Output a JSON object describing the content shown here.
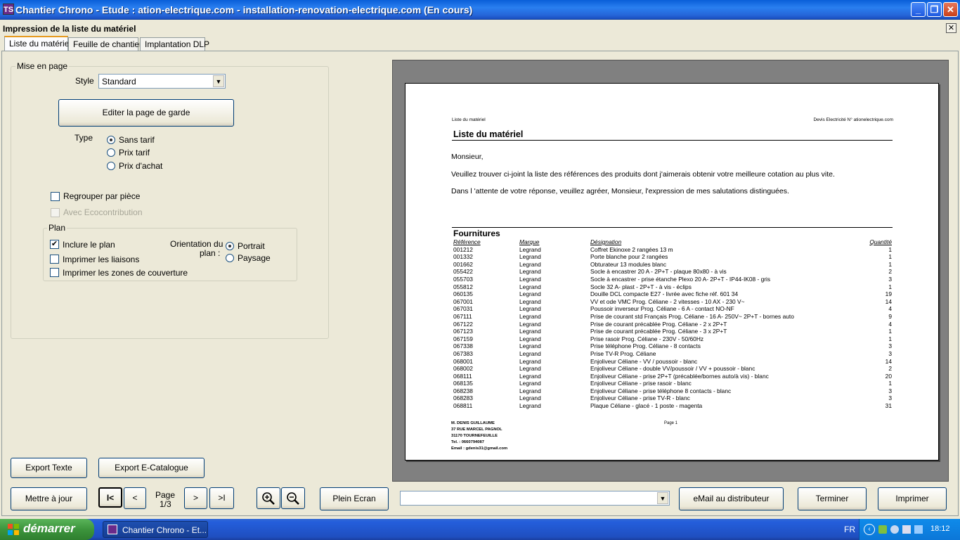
{
  "window": {
    "title": "Chantier Chrono - Etude : ation-electrique.com - installation-renovation-electrique.com (En cours)",
    "app_icon_text": "TS"
  },
  "dialog": {
    "title": "Impression de la liste du matériel",
    "close_glyph": "✕"
  },
  "tabs": [
    {
      "label": "Liste du matériel",
      "active": true
    },
    {
      "label": "Feuille de chantier",
      "active": false
    },
    {
      "label": "Implantation DLP",
      "active": false
    }
  ],
  "settings": {
    "group_title": "Mise en page",
    "style_label": "Style",
    "style_value": "Standard",
    "edit_cover_button": "Editer la page de garde",
    "type_label": "Type",
    "type_options": [
      "Sans tarif",
      "Prix tarif",
      "Prix d'achat"
    ],
    "type_selected": "Sans tarif",
    "group_by_room": "Regrouper par pièce",
    "eco_contribution": "Avec Ecocontribution",
    "plan_group_title": "Plan",
    "include_plan": "Inclure le plan",
    "print_links": "Imprimer les liaisons",
    "print_coverage": "Imprimer les zones de couverture",
    "orientation_label_1": "Orientation du",
    "orientation_label_2": "plan :",
    "orientation_options": [
      "Portrait",
      "Paysage"
    ],
    "orientation_selected": "Portrait",
    "export_text_button": "Export Texte",
    "export_ecatalogue_button": "Export E-Catalogue"
  },
  "preview": {
    "header_left": "Liste du matériel",
    "header_right": "Devis Electricité N° ationelectrique.com",
    "title": "Liste du matériel",
    "salutation": "Monsieur,",
    "paragraph1": "Veuillez trouver ci-joint la liste des références des produits dont j'aimerais obtenir votre meilleure cotation au plus vite.",
    "paragraph2": "Dans l 'attente de votre réponse, veuillez agréer, Monsieur, l'expression de mes salutations distinguées.",
    "section_title": "Fournitures",
    "columns": [
      "Référence",
      "Marque",
      "Désignation",
      "Quantité"
    ],
    "rows": [
      [
        "001212",
        "Legrand",
        "Coffret Ekinoxe 2 rangées 13 m",
        "1"
      ],
      [
        "001332",
        "Legrand",
        "Porte blanche pour 2 rangées",
        "1"
      ],
      [
        "001662",
        "Legrand",
        "Obturateur 13 modules blanc",
        "1"
      ],
      [
        "055422",
        "Legrand",
        "Socle à encastrer 20 A - 2P+T - plaque 80x80 - à vis",
        "2"
      ],
      [
        "055703",
        "Legrand",
        "Socle à encastrer - prise étanche Plexo 20 A- 2P+T - IP44-IK08 - gris",
        "3"
      ],
      [
        "055812",
        "Legrand",
        "Socle 32 A- plast - 2P+T - à vis - éclips",
        "1"
      ],
      [
        "060135",
        "Legrand",
        "Douille DCL compacte E27 - livrée avec fiche réf. 601 34",
        "19"
      ],
      [
        "067001",
        "Legrand",
        "VV et ode VMC Prog. Céliane - 2 vitesses - 10 AX - 230 V~",
        "14"
      ],
      [
        "067031",
        "Legrand",
        "Poussoir inverseur Prog. Céliane - 6 A - contact NO-NF",
        "4"
      ],
      [
        "067111",
        "Legrand",
        "Prise de courant std Français Prog. Céliane - 16 A- 250V~ 2P+T - bornes auto",
        "9"
      ],
      [
        "067122",
        "Legrand",
        "Prise de courant précablée Prog. Céliane - 2 x 2P+T",
        "4"
      ],
      [
        "067123",
        "Legrand",
        "Prise de courant précablée Prog. Céliane - 3 x 2P+T",
        "1"
      ],
      [
        "067159",
        "Legrand",
        "Prise rasoir Prog. Céliane - 230V - 50/60Hz",
        "1"
      ],
      [
        "067338",
        "Legrand",
        "Prise téléphone Prog. Céliane - 8 contacts",
        "3"
      ],
      [
        "067383",
        "Legrand",
        "Prise TV-R Prog. Céliane",
        "3"
      ],
      [
        "068001",
        "Legrand",
        "Enjoliveur Céliane - VV / poussoir - blanc",
        "14"
      ],
      [
        "068002",
        "Legrand",
        "Enjoliveur Céliane - double VV/poussoir / VV + poussoir - blanc",
        "2"
      ],
      [
        "068111",
        "Legrand",
        "Enjoliveur Céliane - prise 2P+T (précablée/bornes auto/à vis) - blanc",
        "20"
      ],
      [
        "068135",
        "Legrand",
        "Enjoliveur Céliane - prise rasoir - blanc",
        "1"
      ],
      [
        "068238",
        "Legrand",
        "Enjoliveur Céliane - prise téléphone 8 contacts - blanc",
        "3"
      ],
      [
        "068283",
        "Legrand",
        "Enjoliveur Céliane - prise TV-R - blanc",
        "3"
      ],
      [
        "068811",
        "Legrand",
        "Plaque Céliane - glacé - 1 poste - magenta",
        "31"
      ]
    ],
    "footer_lines": [
      "M. DENIS GUILLAUME",
      "37 RUE MARCEL PAGNOL",
      "31170 TOURNEFEUILLE",
      "Tel. : 0660794087",
      "Email : gdenis31@gmail.com"
    ],
    "footer_page": "Page 1"
  },
  "toolbar": {
    "update_button": "Mettre à jour",
    "first_glyph": "I<",
    "prev_glyph": "<",
    "page_label": "Page",
    "page_value": "1/3",
    "next_glyph": ">",
    "last_glyph": ">I",
    "fullscreen_button": "Plein Ecran",
    "email_button": "eMail au distributeur",
    "finish_button": "Terminer",
    "print_button": "Imprimer",
    "combo_value": ""
  },
  "taskbar": {
    "start_label": "démarrer",
    "task_label": "Chantier Chrono - Et...",
    "lang": "FR",
    "time": "18:12"
  }
}
